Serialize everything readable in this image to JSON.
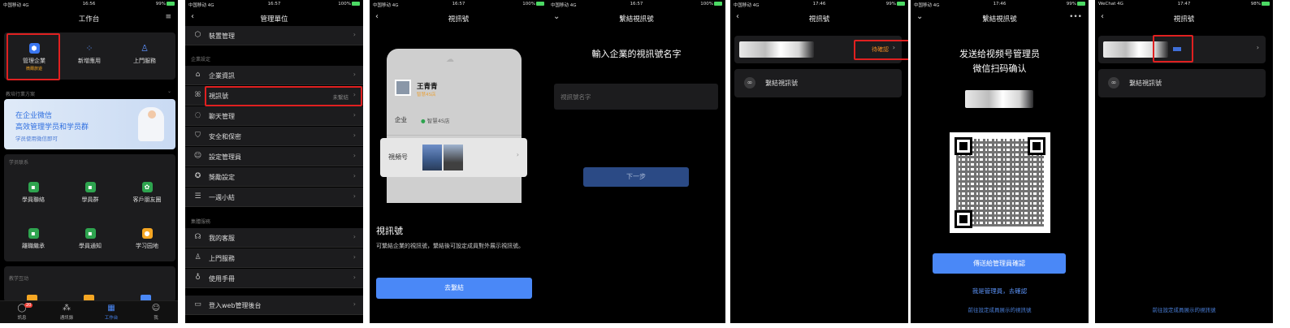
{
  "colors": {
    "accent": "#4a88f7",
    "highlight_red": "#e02020",
    "pending_orange": "#f08a24"
  },
  "status_bars": [
    {
      "carrier": "中国移动 4G",
      "time": "16:56",
      "battery": "99%"
    },
    {
      "carrier": "中国移动 4G",
      "time": "16:57",
      "battery": "100%"
    },
    {
      "carrier": "中国移动 4G",
      "time": "16:57",
      "battery": "100%"
    },
    {
      "carrier": "中国移动 4G",
      "time": "16:57",
      "battery": "100%"
    },
    {
      "carrier": "中国移动 4G",
      "time": "17:46",
      "battery": "99%"
    },
    {
      "carrier": "中国移动 4G",
      "time": "17:46",
      "battery": "99%"
    },
    {
      "carrier": "WeChat 4G",
      "time": "17:47",
      "battery": "98%"
    }
  ],
  "s1": {
    "title": "工作台",
    "apps": [
      {
        "label": "管理企業",
        "sub": "微爾旅遊",
        "icon": "hexagon-icon"
      },
      {
        "label": "新增應用",
        "icon": "grid-plus-icon"
      },
      {
        "label": "上門服務",
        "icon": "tie-icon"
      }
    ],
    "section_recommend": "教培行業方案",
    "banner_line1": "在企业微信",
    "banner_line2": "高效管理学员和学员群",
    "banner_line3": "学员使用微信即可",
    "section_contacts": "学员联系",
    "grid": [
      {
        "label": "學員聯絡",
        "color": "#2ea44f",
        "icon": "chat-icon"
      },
      {
        "label": "學員群",
        "color": "#2ea44f",
        "icon": "group-icon"
      },
      {
        "label": "客戶朋友圈",
        "color": "#2ea44f",
        "icon": "moments-icon"
      },
      {
        "label": "離職繼承",
        "color": "#2ea44f",
        "icon": "handover-icon"
      },
      {
        "label": "學員通知",
        "color": "#2ea44f",
        "icon": "notice-icon"
      },
      {
        "label": "学习园地",
        "color": "#f5a623",
        "icon": "study-icon"
      }
    ],
    "section_teaching": "教学互动",
    "tabs": [
      {
        "label": "訊息",
        "icon": "chat-bubble-icon",
        "badge": "20"
      },
      {
        "label": "通訊錄",
        "icon": "contacts-icon"
      },
      {
        "label": "工作台",
        "icon": "workbench-icon"
      },
      {
        "label": "我",
        "icon": "person-icon"
      }
    ]
  },
  "s2": {
    "title": "管理單位",
    "row_top": "裝置管理",
    "section_settings": "企業設定",
    "rows": [
      {
        "label": "企業資訊",
        "icon": "home-icon"
      },
      {
        "label": "視訊號",
        "value": "未繫結",
        "icon": "butterfly-icon"
      },
      {
        "label": "聊天管理",
        "icon": "chat-icon"
      },
      {
        "label": "安全和保密",
        "icon": "shield-icon"
      },
      {
        "label": "設定管理員",
        "icon": "person-icon"
      },
      {
        "label": "獎勵設定",
        "icon": "award-icon"
      },
      {
        "label": "一週小結",
        "icon": "list-icon"
      }
    ],
    "section_services": "集體服務",
    "rows2": [
      {
        "label": "我的客服",
        "icon": "headset-icon"
      },
      {
        "label": "上門服務",
        "icon": "tie-icon"
      },
      {
        "label": "使用手冊",
        "icon": "bulb-icon"
      }
    ],
    "web_admin": "登入web管理後台"
  },
  "s3": {
    "title": "視訊號",
    "profile_name": "王青青",
    "profile_tag": "智慧4S店",
    "company_label": "企业",
    "company_value": "智慧4S店",
    "channel_label": "視頻号",
    "heading": "視訊號",
    "desc": "可繫結企業的視訊號，繫結後可設定成員對外展示視訊號。",
    "button": "去繫結"
  },
  "s4": {
    "title": "繫結視訊號",
    "heading": "輸入企業的視訊號名字",
    "placeholder": "視訊號名字",
    "button": "下一步"
  },
  "s5": {
    "title": "視訊號",
    "pending": "待確認",
    "bind_label": "繫結視訊號"
  },
  "s6": {
    "title": "繫結視訊號",
    "heading_line1": "发送给视频号管理员",
    "heading_line2": "微信扫码确认",
    "send_button": "傳送給管理員確認",
    "admin_link": "我是管理員，去確認",
    "footer_link": "前往設定成員展示的視訊號"
  },
  "s7": {
    "title": "視訊號",
    "bind_label": "繫結視訊號",
    "footer_link": "前往設定成員展示的視訊號"
  }
}
